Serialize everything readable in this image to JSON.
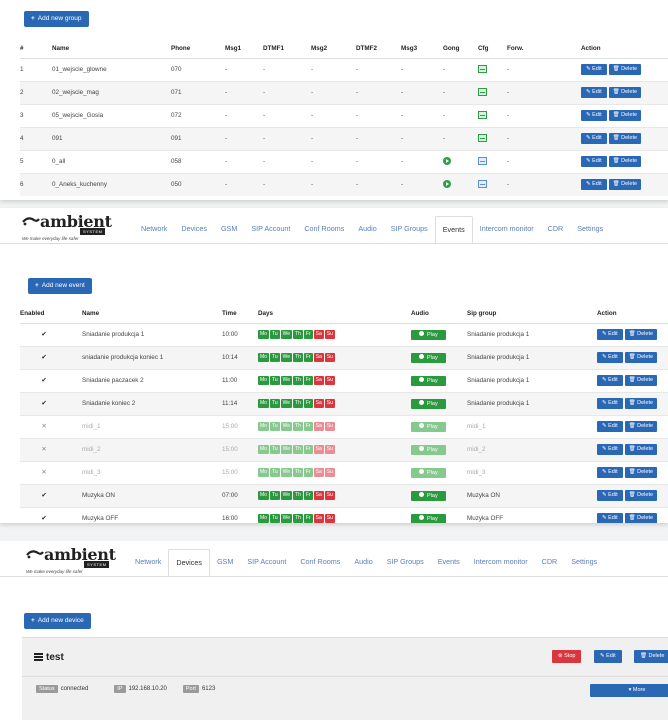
{
  "groups_panel": {
    "add_label": "Add new group",
    "headers": [
      "#",
      "Name",
      "Phone",
      "Msg1",
      "DTMF1",
      "Msg2",
      "DTMF2",
      "Msg3",
      "Gong",
      "Cfg",
      "Forw.",
      "Action"
    ],
    "edit_label": "Edit",
    "delete_label": "Delete",
    "rows": [
      {
        "no": "1",
        "name": "01_wejscie_glowne",
        "phone": "070",
        "msg1": "-",
        "dtmf1": "-",
        "msg2": "-",
        "dtmf2": "-",
        "msg3": "-",
        "gong": "-",
        "forw": "-"
      },
      {
        "no": "2",
        "name": "02_wejscie_mag",
        "phone": "071",
        "msg1": "-",
        "dtmf1": "-",
        "msg2": "-",
        "dtmf2": "-",
        "msg3": "-",
        "gong": "-",
        "forw": "-"
      },
      {
        "no": "3",
        "name": "05_wejscie_Gosia",
        "phone": "072",
        "msg1": "-",
        "dtmf1": "-",
        "msg2": "-",
        "dtmf2": "-",
        "msg3": "-",
        "gong": "-",
        "forw": "-"
      },
      {
        "no": "4",
        "name": "091",
        "phone": "091",
        "msg1": "-",
        "dtmf1": "-",
        "msg2": "-",
        "dtmf2": "-",
        "msg3": "-",
        "gong": "-",
        "forw": "-"
      },
      {
        "no": "5",
        "name": "0_all",
        "phone": "058",
        "msg1": "-",
        "dtmf1": "-",
        "msg2": "-",
        "dtmf2": "-",
        "msg3": "-",
        "gong": "",
        "forw": "-"
      },
      {
        "no": "6",
        "name": "0_Aneks_kuchenny",
        "phone": "050",
        "msg1": "-",
        "dtmf1": "-",
        "msg2": "-",
        "dtmf2": "-",
        "msg3": "-",
        "gong": "",
        "forw": "-"
      }
    ]
  },
  "brand": {
    "name": "ambient",
    "badge": "SYSTEM",
    "tagline": "We make everyday life safer"
  },
  "nav_tabs": [
    "Network",
    "Devices",
    "GSM",
    "SIP Account",
    "Conf Rooms",
    "Audio",
    "SIP Groups",
    "Events",
    "Intercom monitor",
    "CDR",
    "Settings"
  ],
  "events_panel": {
    "active_tab": "Events",
    "add_label": "Add new event",
    "headers": [
      "Enabled",
      "Name",
      "Time",
      "Days",
      "Audio",
      "Sip group",
      "Action"
    ],
    "day_labels": [
      "Mo",
      "Tu",
      "We",
      "Th",
      "Fr",
      "Sa",
      "Su"
    ],
    "play_label": "Play",
    "edit_label": "Edit",
    "delete_label": "Delete",
    "rows": [
      {
        "enabled": "✔",
        "name": "Sniadanie produkcja 1",
        "time": "10:00",
        "sip": "Sniadanie produkcja 1",
        "on": true
      },
      {
        "enabled": "✔",
        "name": "sniadanie produkcja koniec 1",
        "time": "10:14",
        "sip": "Sniadanie produkcja 1",
        "on": true
      },
      {
        "enabled": "✔",
        "name": "Sniadanie paczacek 2",
        "time": "11:00",
        "sip": "Sniadanie produkcja 1",
        "on": true
      },
      {
        "enabled": "✔",
        "name": "Sniadanie koniec 2",
        "time": "11:14",
        "sip": "Sniadanie produkcja 1",
        "on": true
      },
      {
        "enabled": "✕",
        "name": "midi_1",
        "time": "15:00",
        "sip": "midi_1",
        "on": false
      },
      {
        "enabled": "✕",
        "name": "midi_2",
        "time": "15:00",
        "sip": "midi_2",
        "on": false
      },
      {
        "enabled": "✕",
        "name": "midi_3",
        "time": "15:00",
        "sip": "midi_3",
        "on": false
      },
      {
        "enabled": "✔",
        "name": "Muzyka ON",
        "time": "07:00",
        "sip": "Muzyka ON",
        "on": true
      },
      {
        "enabled": "✔",
        "name": "Muzyka OFF",
        "time": "16:00",
        "sip": "Muzyka OFF",
        "on": true
      }
    ]
  },
  "devices_panel": {
    "active_tab": "Devices",
    "add_label": "Add new device",
    "device": {
      "name": "test",
      "stop_label": "Stop",
      "edit_label": "Edit",
      "delete_label": "Delete",
      "status_label": "Status",
      "status_value": "connected",
      "ip_label": "IP",
      "ip_value": "192.168.10.20",
      "port_label": "Port",
      "port_value": "6123",
      "more_label": "More"
    }
  },
  "colors": {
    "primary": "#2a68b6",
    "success": "#2b9a3e",
    "danger": "#d9363e"
  }
}
